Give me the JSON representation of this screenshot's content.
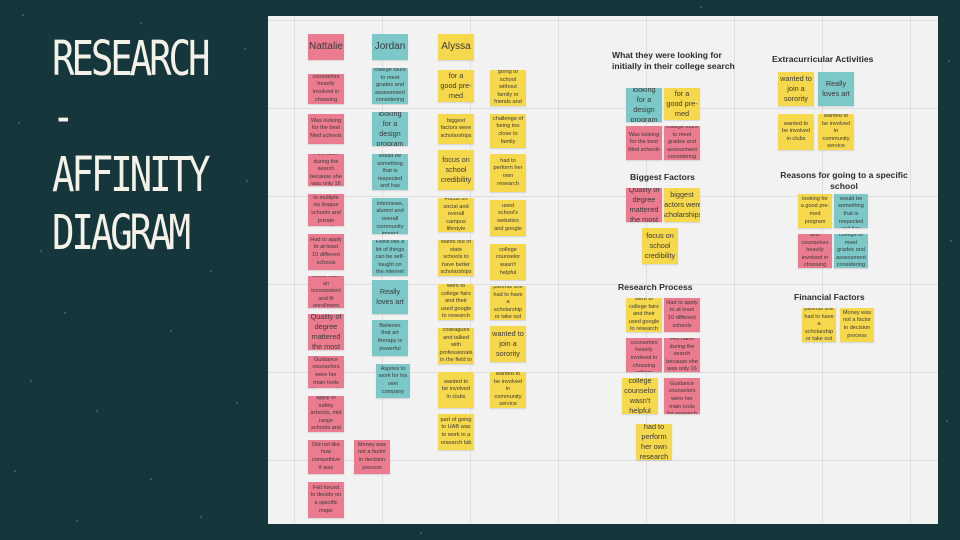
{
  "title": "RESEARCH -\nAFFINITY\nDIAGRAM",
  "colors": {
    "background": "#15363a",
    "board": "#f2f2f2",
    "pink": "#eb7b8f",
    "yellow": "#f6d84c",
    "teal": "#7cc7c7",
    "title_text": "#f3f1e8"
  },
  "columns": {
    "nattalie": {
      "name": "Nattalie",
      "notes": [
        "Parents and counselors heavily involved in choosing college",
        "Was looking for the best Med schools",
        "Felt naive during the search because she was only 16",
        "She applied to multiple ivy league schools and private universities",
        "Had to apply to at least 10 different schools",
        "If not college board she would have an inconsistent and fit enrollment process infused",
        "Quality of degree mattered the most",
        "Two Guidance counselors were her main tools for research",
        "Wet told to apply to safety schools, mid range schools and top schools",
        "Did not like how competitive it was",
        "Money was not a factor in decision process",
        "Felt forced to decide on a specific major"
      ]
    },
    "jordan": {
      "name": "Jordan",
      "notes": [
        "Went to college tours to meet grades and assessment considering attached",
        "looking for a design program",
        "Ideal college would be something that is respected and has prestige",
        "Her school's interviews, alumni and overall community impact",
        "Feels like a lot of things can be self-taught on the internet",
        "Really loves art",
        "Believes that art therapy is powerful",
        "Aspires to work for his own company"
      ]
    },
    "alyssa": {
      "name": "Alyssa",
      "notes_a": [
        "looking for a good pre-med program",
        "biggest factors were scholarships",
        "focus on school credibility",
        "Focus on social and overall campus lifestyle",
        "wants out of state schools to have better scholarships",
        "went to college fairs and their used google to research",
        "Spoke to upperclass colleagues and talked with professionals in the field to decide on a choice",
        "wanted to be involved in clubs",
        "part of going to UAB was to work in a research lab"
      ],
      "notes_b": [
        "challenge of going to school without family or friends and being alone",
        "challenge of being too close to family",
        "had to perform her own research",
        "used school's websites and google",
        "college counselor wasn't helpful",
        "was told by parents she had to have a scholarship or take out loans",
        "wanted to join a sorority",
        "wanted to be involved in community service"
      ]
    }
  },
  "groups": {
    "looking_for": {
      "heading": "What they were looking for initially in their college search",
      "notes": [
        "looking for a design program",
        "looking for a good pre-med program",
        "Was looking for the best Med schools",
        "Went to college tours to meet grades and assessment considering attached"
      ]
    },
    "biggest": {
      "heading": "Biggest Factors",
      "notes": [
        "Quality of degree mattered the most",
        "biggest factors were scholarships",
        "focus on school credibility"
      ]
    },
    "research": {
      "heading": "Research Process",
      "notes": [
        "went to college fairs and their used google to research",
        "Had to apply to at least 10 different schools",
        "Parents and counselors heavily involved in choosing college",
        "Felt naive during the search because she was only 16",
        "college counselor wasn't helpful",
        "Two Guidance counselors were her main tools for research",
        "had to perform her own research"
      ]
    },
    "extracurricular": {
      "heading": "Extracurricular Activities",
      "notes": [
        "wanted to join a sorority",
        "Really loves art",
        "wanted to be involved in clubs",
        "wanted to be involved in community service"
      ]
    },
    "reasons": {
      "heading": "Reasons for going to a specific school",
      "notes": [
        "looking for a good pre-med program",
        "Ideal college would be something that is respected and has prestige",
        "Parents and counselors heavily involved in choosing college",
        "went to college to meet grades and assessment considering attached"
      ]
    },
    "financial": {
      "heading": "Financial Factors",
      "notes": [
        "was told by parents she had to have a scholarship or take out loans",
        "Money was not a factor in decision process"
      ]
    }
  }
}
